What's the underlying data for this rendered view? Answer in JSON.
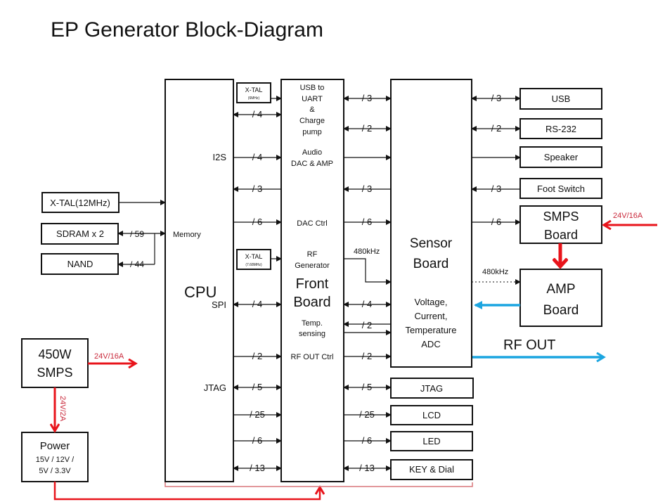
{
  "title": "EP Generator Block-Diagram",
  "colors": {
    "power": "#e8141b",
    "rf": "#1ba5e0",
    "line": "#111111",
    "bracket": "#d9777a"
  },
  "cpu": {
    "label": "CPU",
    "ports": {
      "i2s": "I2S",
      "memory": "Memory",
      "spi": "SPI",
      "jtag": "JTAG"
    }
  },
  "front_board": {
    "label_line1": "Front",
    "label_line2": "Board",
    "functions": {
      "usb_uart": [
        "USB to",
        "UART",
        "&",
        "Charge",
        "pump"
      ],
      "audio": [
        "Audio",
        "DAC & AMP"
      ],
      "dac_ctrl": "DAC Ctrl",
      "rf_gen": [
        "RF",
        "Generator"
      ],
      "temp": [
        "Temp.",
        "sensing"
      ],
      "rf_out_ctrl": "RF OUT Ctrl"
    }
  },
  "xtal_6": {
    "label": "X-TAL",
    "freq": "(6MHz)"
  },
  "xtal_768": {
    "label": "X-TAL",
    "freq": "(7.68MHz)"
  },
  "sensor_board": {
    "label_line1": "Sensor",
    "label_line2": "Board",
    "adc": [
      "Voltage,",
      "Current,",
      "Temperature",
      "ADC"
    ]
  },
  "left_components": {
    "xtal": "X-TAL(12MHz)",
    "sdram": "SDRAM x 2",
    "nand": "NAND",
    "sdram_bus": "/ 59",
    "nand_bus": "/ 44"
  },
  "peripherals": {
    "usb": "USB",
    "rs232": "RS-232",
    "speaker": "Speaker",
    "foot_switch": "Foot Switch"
  },
  "smps_board": [
    "SMPS",
    "Board"
  ],
  "amp_board": [
    "AMP",
    "Board"
  ],
  "freq_label": "480kHz",
  "rf_out": "RF OUT",
  "power_in": "24V/16A",
  "smps_450": [
    "450W",
    "SMPS"
  ],
  "smps_out": "24V/16A",
  "power_supply_feed": "24V/2A",
  "power_block": [
    "Power",
    "15V / 12V /",
    "5V / 3.3V"
  ],
  "lower_peripherals": {
    "jtag": "JTAG",
    "lcd": "LCD",
    "led": "LED",
    "key_dial": "KEY & Dial"
  },
  "cpu_front_buses": [
    "/ 4",
    "/ 4",
    "/ 3",
    "/ 6",
    "/ 4",
    "/ 2",
    "/ 5",
    "/ 25",
    "/ 6",
    "/ 13"
  ],
  "front_sensor_buses": [
    "/ 3",
    "/ 2",
    "/ 3",
    "/ 6",
    "/ 4",
    "/ 2",
    "/ 2",
    "/ 5",
    "/ 25",
    "/ 6",
    "/ 13"
  ],
  "sensor_peripheral_buses": [
    "/ 3",
    "/ 2",
    "/ 3",
    "/ 6"
  ]
}
